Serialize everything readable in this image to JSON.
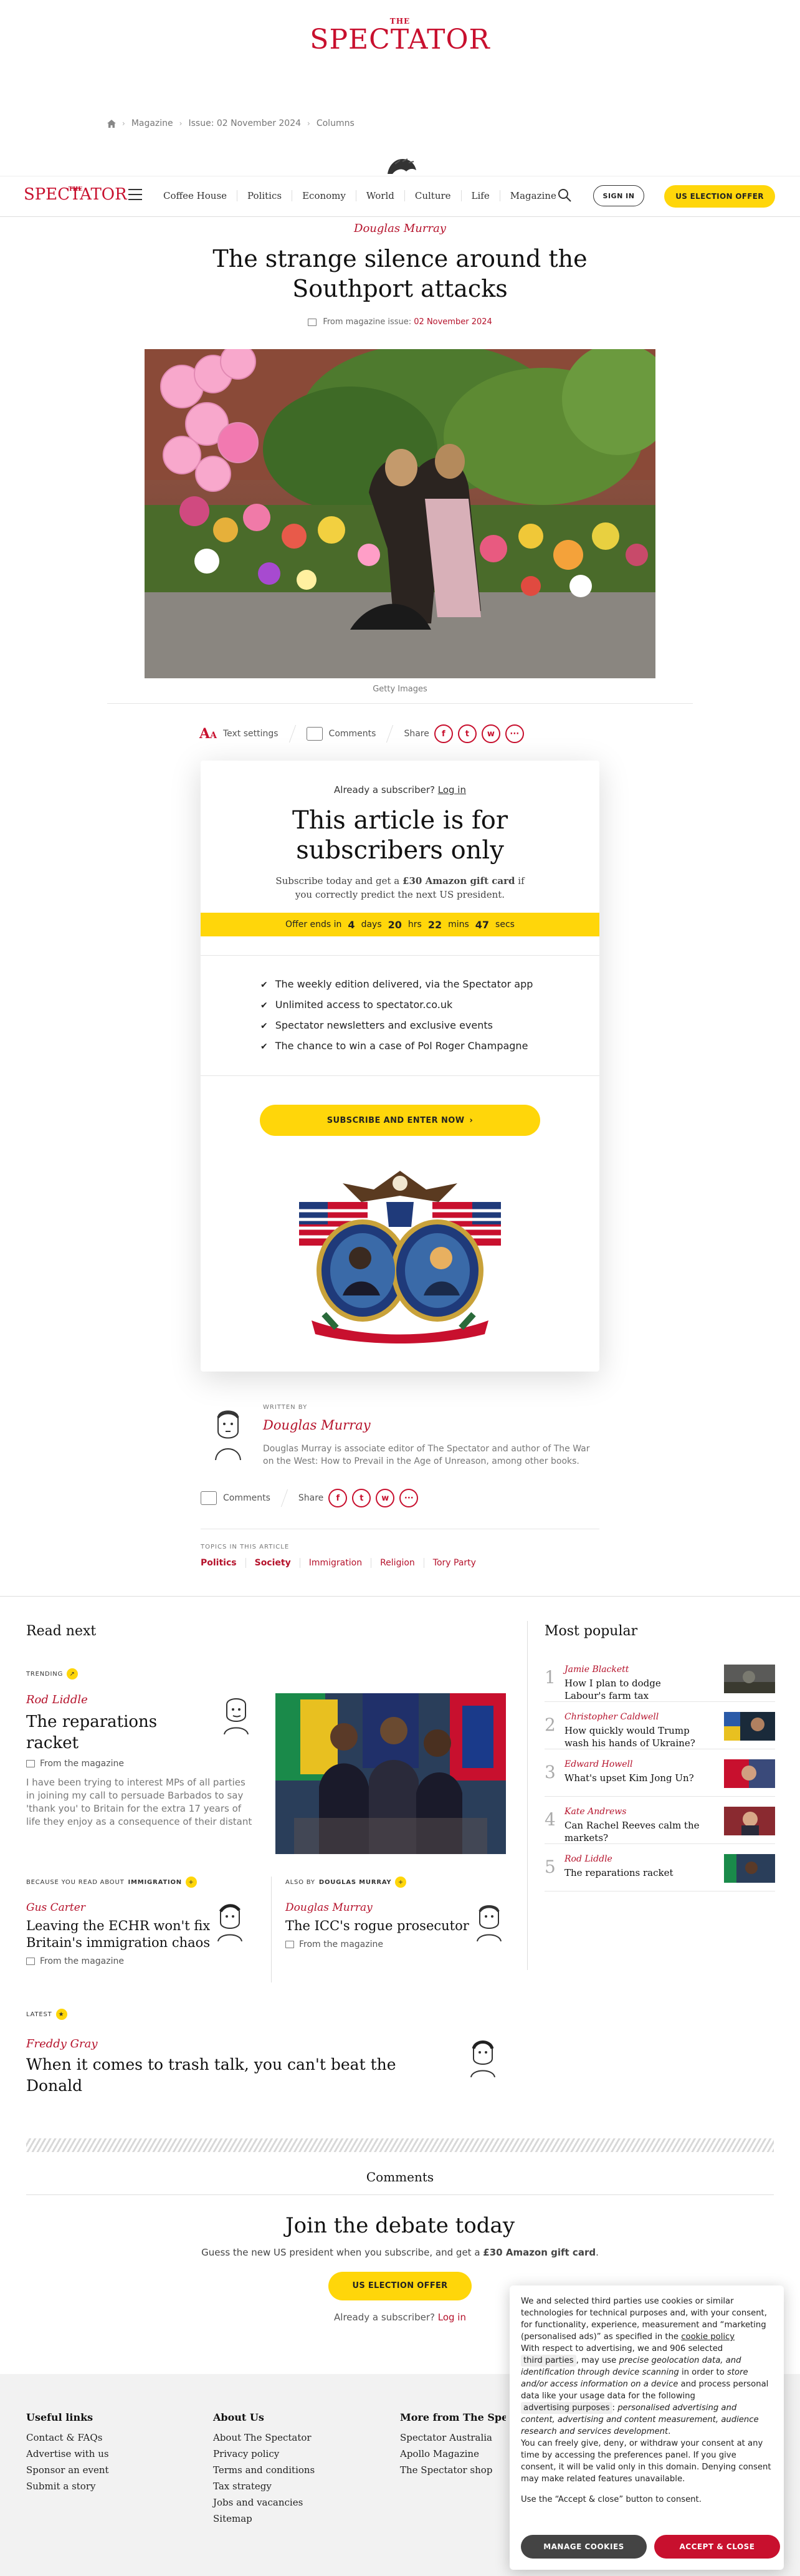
{
  "masthead": {
    "small": "THE",
    "big": "SPECTATOR"
  },
  "breadcrumb": [
    "Magazine",
    "Issue: 02 November 2024",
    "Columns"
  ],
  "nav": {
    "brand_small": "THE",
    "brand": "SPECTATOR",
    "links": [
      "Coffee House",
      "Politics",
      "Economy",
      "World",
      "Culture",
      "Life",
      "Magazine"
    ],
    "signin": "SIGN IN",
    "election": "US ELECTION OFFER"
  },
  "article": {
    "author": "Douglas Murray",
    "title": "The strange silence around the Southport attacks",
    "issue_prefix": "From magazine issue:",
    "issue_date": "02 November 2024",
    "caption": "Getty Images"
  },
  "toolbar": {
    "text_settings": "Text settings",
    "comments": "Comments",
    "share": "Share"
  },
  "paywall": {
    "already": "Already a subscriber?",
    "login": "Log in",
    "heading": "This article is for subscribers only",
    "sub_1": "Subscribe today and get a",
    "sub_bold": "£30 Amazon gift card",
    "sub_2": "if you correctly predict the next US president.",
    "offer_label": "Offer ends in",
    "days": "4",
    "days_u": "days",
    "hrs": "20",
    "hrs_u": "hrs",
    "mins": "22",
    "mins_u": "mins",
    "secs": "47",
    "secs_u": "secs",
    "benefits": [
      "The weekly edition delivered, via the Spectator app",
      "Unlimited access to spectator.co.uk",
      "Spectator newsletters and exclusive events",
      "The chance to win a case of Pol Roger Champagne"
    ],
    "cta": "SUBSCRIBE AND ENTER NOW"
  },
  "author_box": {
    "written_by": "WRITTEN BY",
    "name": "Douglas Murray",
    "bio": "Douglas Murray is associate editor of The Spectator and author of The War on the West: How to Prevail in the Age of Unreason, among other books."
  },
  "topics": {
    "label": "TOPICS IN THIS ARTICLE",
    "items": [
      "Politics",
      "Society",
      "Immigration",
      "Religion",
      "Tory Party"
    ]
  },
  "read_next": {
    "title": "Read next",
    "trending": "TRENDING",
    "lead": {
      "author": "Rod Liddle",
      "title": "The reparations racket",
      "from": "From the magazine",
      "excerpt": "I have been trying to interest MPs of all parties in joining my call to persuade Barbados to say 'thank you' to Britain for the extra 17 years of life they enjoy as a consequence of their distant ancestors"
    },
    "because_label": "BECAUSE YOU READ ABOUT",
    "because_topic": "IMMIGRATION",
    "because": {
      "author": "Gus Carter",
      "title": "Leaving the ECHR won't fix Britain's immigration chaos",
      "from": "From the magazine"
    },
    "also_label": "ALSO BY",
    "also_author_label": "DOUGLAS MURRAY",
    "also": {
      "author": "Douglas Murray",
      "title": "The ICC's rogue prosecutor",
      "from": "From the magazine"
    },
    "latest_label": "LATEST",
    "latest": {
      "author": "Freddy Gray",
      "title": "When it comes to trash talk, you can't beat the Donald"
    }
  },
  "popular": {
    "title": "Most popular",
    "items": [
      {
        "n": "1",
        "author": "Jamie Blackett",
        "title": "How I plan to dodge Labour's farm tax"
      },
      {
        "n": "2",
        "author": "Christopher Caldwell",
        "title": "How quickly would Trump wash his hands of Ukraine?"
      },
      {
        "n": "3",
        "author": "Edward Howell",
        "title": "What's upset Kim Jong Un?"
      },
      {
        "n": "4",
        "author": "Kate Andrews",
        "title": "Can Rachel Reeves calm the markets?"
      },
      {
        "n": "5",
        "author": "Rod Liddle",
        "title": "The reparations racket"
      }
    ]
  },
  "comments": {
    "title": "Comments",
    "heading": "Join the debate today",
    "guess_1": "Guess the new US president when you subscribe, and get a",
    "guess_bold": "£30 Amazon gift card",
    "guess_2": ".",
    "btn": "US ELECTION OFFER",
    "already": "Already a subscriber?",
    "login": "Log in"
  },
  "footer": {
    "useful": {
      "title": "Useful links",
      "items": [
        "Contact & FAQs",
        "Advertise with us",
        "Sponsor an event",
        "Submit a story"
      ]
    },
    "about": {
      "title": "About Us",
      "items": [
        "About The Spectator",
        "Privacy policy",
        "Terms and conditions",
        "Tax strategy",
        "Jobs and vacancies",
        "Sitemap"
      ]
    },
    "more": {
      "title": "More from The Spectator",
      "items": [
        "Spectator Australia",
        "Apollo Magazine",
        "The Spectator shop"
      ]
    }
  },
  "cookie": {
    "p1": "We and selected third parties use cookies or similar technologies for technical purposes and, with your consent, for functionality, experience, measurement and “marketing (personalised ads)” as specified in the",
    "p1_link": "cookie policy",
    "p2a": "With respect to advertising, we and 906 selected",
    "p2_chip1": "third parties",
    "p2b": ", may use",
    "p2_i1": "precise geolocation data, and identification through device scanning",
    "p2c": "in order to",
    "p2_i2": "store and/or access information on a device",
    "p2d": "and process personal data like your usage data for the following",
    "p2_chip2": "advertising purposes",
    "p2e": ":",
    "p2_i3": "personalised advertising and content, advertising and content measurement, audience research and services development",
    "p3": "You can freely give, deny, or withdraw your consent at any time by accessing the preferences panel. If you give consent, it will be valid only in this domain. Denying consent may make related features unavailable.",
    "p4": "Use the “Accept & close” button to consent.",
    "manage": "MANAGE COOKIES",
    "accept": "ACCEPT & CLOSE"
  }
}
